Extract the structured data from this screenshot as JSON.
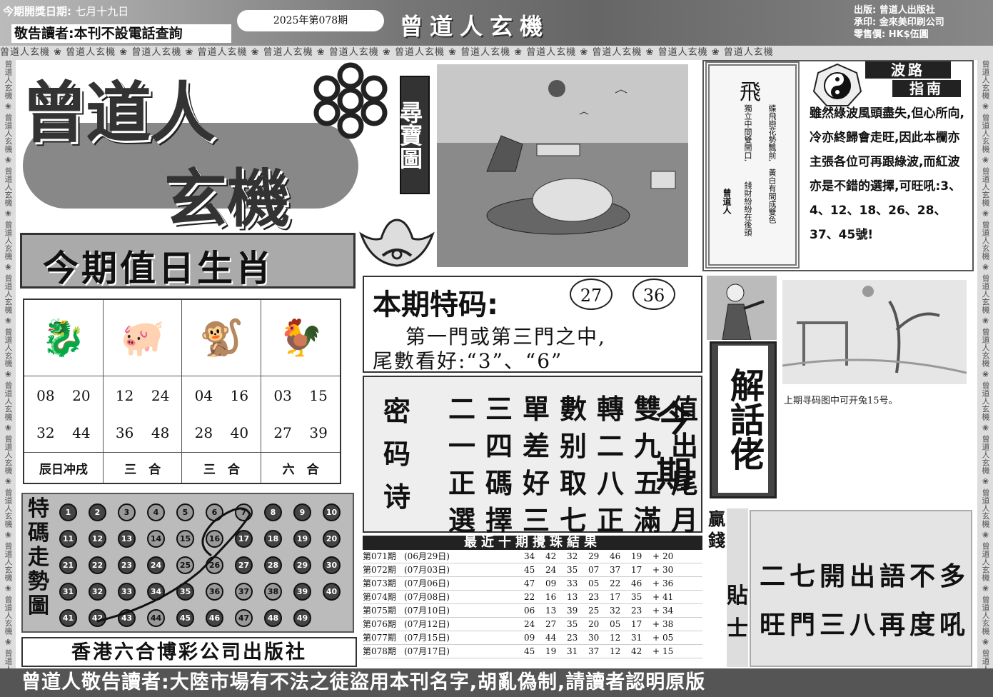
{
  "header": {
    "draw_date_label": "今期開獎日期:",
    "draw_date": "七月十九日",
    "notice": "敬告讀者:本刊不設電話查詢",
    "issue": "2025年第078期",
    "title": "曾道人玄機",
    "publisher_line": "出版: 曾道人出版社",
    "printer_line": "承印: 金來美印刷公司",
    "price_line": "零售價: HK$伍圓"
  },
  "watermark": "曾道人玄機",
  "side_watermark": "曾道人玄機",
  "logo": {
    "line1": "曾道人",
    "line2": "玄機",
    "treasure_label": "尋寶圖"
  },
  "zodiac": {
    "title": "今期值日生肖",
    "columns": [
      {
        "icon": "dragon-icon",
        "glyph": "🐉",
        "numbers": [
          "08",
          "20",
          "32",
          "44"
        ],
        "relation": "辰日冲戌"
      },
      {
        "icon": "pig-icon",
        "glyph": "🐖",
        "numbers": [
          "12",
          "24",
          "36",
          "48"
        ],
        "relation": "三　合"
      },
      {
        "icon": "monkey-icon",
        "glyph": "🐒",
        "numbers": [
          "04",
          "16",
          "28",
          "40"
        ],
        "relation": "三　合"
      },
      {
        "icon": "rooster-icon",
        "glyph": "🐓",
        "numbers": [
          "03",
          "15",
          "27",
          "39"
        ],
        "relation": "六　合"
      }
    ]
  },
  "trend": {
    "label": "特碼走勢圖",
    "balls": [
      "1",
      "2",
      "3",
      "4",
      "5",
      "6",
      "7",
      "8",
      "9",
      "10",
      "11",
      "12",
      "13",
      "14",
      "15",
      "16",
      "17",
      "18",
      "19",
      "20",
      "21",
      "22",
      "23",
      "24",
      "25",
      "26",
      "27",
      "28",
      "29",
      "30",
      "31",
      "32",
      "33",
      "34",
      "35",
      "36",
      "37",
      "38",
      "39",
      "40",
      "41",
      "42",
      "43",
      "44",
      "45",
      "46",
      "47",
      "48",
      "49"
    ],
    "light": [
      "3",
      "4",
      "5",
      "6",
      "7",
      "14",
      "15",
      "16",
      "25",
      "26",
      "36",
      "37",
      "38",
      "44",
      "47"
    ]
  },
  "publisher": "香港六合博彩公司出版社",
  "special": {
    "title": "本期特码:",
    "numbers": [
      "27",
      "36"
    ],
    "line1": "第一門或第三門之中,",
    "line2": "尾數看好:“3”、“6”"
  },
  "poem": {
    "label": "密码诗",
    "lines": [
      "二三單數轉雙值",
      "一四差别二九出",
      "正碼好取八五尾",
      "選擇三七正滿月"
    ],
    "right_label": "今期"
  },
  "results": {
    "title": "最近十期攪珠結果",
    "rows": [
      {
        "issue": "第071期",
        "date": "(06月29日)",
        "nums": [
          "34",
          "42",
          "32",
          "29",
          "46",
          "19"
        ],
        "special": "20"
      },
      {
        "issue": "第072期",
        "date": "(07月03日)",
        "nums": [
          "45",
          "24",
          "35",
          "07",
          "37",
          "17"
        ],
        "special": "30"
      },
      {
        "issue": "第073期",
        "date": "(07月06日)",
        "nums": [
          "47",
          "09",
          "33",
          "05",
          "22",
          "46"
        ],
        "special": "36"
      },
      {
        "issue": "第074期",
        "date": "(07月08日)",
        "nums": [
          "22",
          "16",
          "13",
          "23",
          "17",
          "35"
        ],
        "special": "41"
      },
      {
        "issue": "第075期",
        "date": "(07月10日)",
        "nums": [
          "06",
          "13",
          "39",
          "25",
          "32",
          "23"
        ],
        "special": "34"
      },
      {
        "issue": "第076期",
        "date": "(07月12日)",
        "nums": [
          "24",
          "27",
          "35",
          "20",
          "05",
          "17"
        ],
        "special": "38"
      },
      {
        "issue": "第077期",
        "date": "(07月15日)",
        "nums": [
          "09",
          "44",
          "23",
          "30",
          "12",
          "31"
        ],
        "special": "05"
      },
      {
        "issue": "第078期",
        "date": "(07月17日)",
        "nums": [
          "45",
          "19",
          "31",
          "37",
          "12",
          "42"
        ],
        "special": "15"
      }
    ]
  },
  "fly": {
    "title": "飛",
    "col1": "蝶飛戀花勢飄前,",
    "col2": "黃白有間成雙色",
    "col3": "獨立中間雙開口,",
    "col4": "錢財紛紛在後頭",
    "author": "曾道人"
  },
  "wave": {
    "title1": "波路",
    "title2": "指南",
    "text": "雖然綠波風頭盡失,但心所向,冷亦終歸會走旺,因此本欄亦主張各位可再跟綠波,而紅波亦是不錯的選擇,可旺吼:3、4、12、18、26、28、37、45號!"
  },
  "explain": {
    "label": "解話佬",
    "caption": "上期寻码图中可开兔15号。"
  },
  "tips": {
    "label1": "贏錢",
    "label2": "貼士",
    "lines": [
      "二七開出語不多",
      "旺門三八再度吼"
    ]
  },
  "footer": "曾道人敬告讀者:大陸市場有不法之徒盜用本刊名字,胡亂偽制,請讀者認明原版"
}
